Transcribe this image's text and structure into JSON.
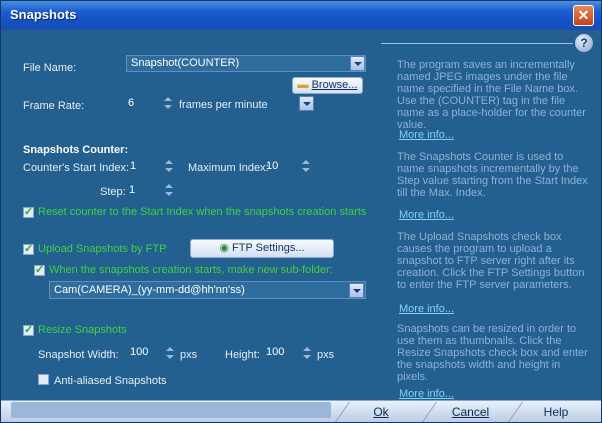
{
  "window": {
    "title": "Snapshots"
  },
  "file_name": {
    "label": "File Name:",
    "value": "Snapshot(COUNTER)",
    "browse_label": "Browse..."
  },
  "frame_rate": {
    "label": "Frame Rate:",
    "value": "6",
    "unit": "frames per minute"
  },
  "counter": {
    "heading": "Snapshots Counter:",
    "start_label": "Counter's Start Index:",
    "start_value": "1",
    "max_label": "Maximum Index:",
    "max_value": "10",
    "step_label": "Step:",
    "step_value": "1",
    "reset_label": "Reset counter to the Start Index when the snapshots creation starts"
  },
  "ftp": {
    "upload_label": "Upload Snapshots by FTP",
    "settings_label": "FTP Settings...",
    "subfolder_label": "When the snapshots creation starts, make new sub-folder:",
    "subfolder_value": "Cam(CAMERA)_(yy-mm-dd@hh'nn'ss)"
  },
  "resize": {
    "label": "Resize Snapshots",
    "width_label": "Snapshot Width:",
    "width_value": "100",
    "width_unit": "pxs",
    "height_label": "Height:",
    "height_value": "100",
    "height_unit": "pxs",
    "aa_label": "Anti-aliased Snapshots"
  },
  "help": {
    "texts": [
      "The program saves an incrementally named JPEG images under the file name specified in the File Name box. Use the (COUNTER) tag in the file name as a place-holder for the counter value.",
      "The Snapshots Counter is used to name snapshots incrementally by the Step value starting from the Start Index till the Max. Index.",
      "The Upload Snapshots check box causes the program to upload a snapshot to FTP server right after its creation. Click the FTP Settings button to enter the FTP server parameters.",
      "Snapshots can be resized in order to use them as thumbnails. Click the Resize Snapshots check box and enter the snapshots width and height in pixels."
    ],
    "more_info": "More info..."
  },
  "buttons": {
    "ok": "Ok",
    "cancel": "Cancel",
    "help": "Help"
  },
  "icons": {
    "close": "close-icon",
    "help": "question-icon",
    "folder": "folder-icon",
    "globe": "globe-icon"
  }
}
